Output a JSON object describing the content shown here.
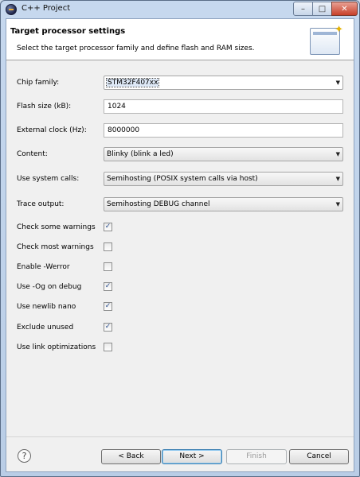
{
  "window": {
    "title": "C++ Project"
  },
  "header": {
    "title": "Target processor settings",
    "description": "Select the target processor family and define flash and RAM sizes."
  },
  "form": {
    "chip_family": {
      "label": "Chip family:",
      "value": "STM32F407xx"
    },
    "flash_size": {
      "label": "Flash size (kB):",
      "value": "1024"
    },
    "external_clock": {
      "label": "External clock (Hz):",
      "value": "8000000"
    },
    "content": {
      "label": "Content:",
      "value": "Blinky (blink a led)"
    },
    "system_calls": {
      "label": "Use system calls:",
      "value": "Semihosting (POSIX system calls via host)"
    },
    "trace_output": {
      "label": "Trace output:",
      "value": "Semihosting DEBUG channel"
    },
    "checkboxes": [
      {
        "label": "Check some warnings",
        "checked": true
      },
      {
        "label": "Check most warnings",
        "checked": false
      },
      {
        "label": "Enable -Werror",
        "checked": false
      },
      {
        "label": "Use -Og on debug",
        "checked": true
      },
      {
        "label": "Use newlib nano",
        "checked": true
      },
      {
        "label": "Exclude unused",
        "checked": true
      },
      {
        "label": "Use link optimizations",
        "checked": false
      }
    ]
  },
  "buttons": {
    "help": "?",
    "back": "< Back",
    "next": "Next >",
    "finish": "Finish",
    "cancel": "Cancel"
  },
  "glyphs": {
    "check": "✓",
    "dropdown": "▼",
    "minimize": "–",
    "maximize": "□",
    "close": "✕",
    "sparkle": "✦"
  }
}
